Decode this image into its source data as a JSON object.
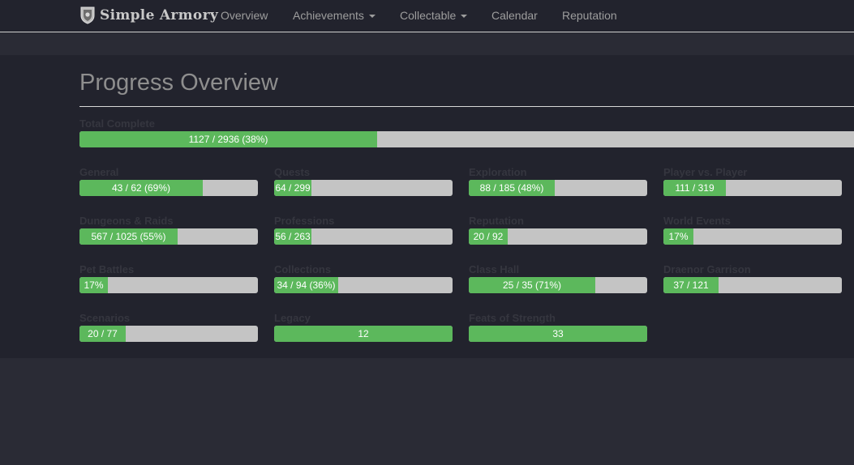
{
  "nav": {
    "brand": "Simple Armory",
    "items": [
      {
        "label": "Overview",
        "dropdown": false
      },
      {
        "label": "Achievements",
        "dropdown": true
      },
      {
        "label": "Collectable",
        "dropdown": true
      },
      {
        "label": "Calendar",
        "dropdown": false
      },
      {
        "label": "Reputation",
        "dropdown": false
      }
    ]
  },
  "page": {
    "title": "Progress Overview"
  },
  "total": {
    "label": "Total Complete",
    "text": "1127 / 2936 (38%)",
    "fraction": 0.384
  },
  "categories": [
    {
      "label": "General",
      "text": "43 / 62 (69%)",
      "fraction": 0.69
    },
    {
      "label": "Quests",
      "text": "64 / 299",
      "fraction": 0.21
    },
    {
      "label": "Exploration",
      "text": "88 / 185 (48%)",
      "fraction": 0.48
    },
    {
      "label": "Player vs. Player",
      "text": "111 / 319",
      "fraction": 0.35
    },
    {
      "label": "Dungeons & Raids",
      "text": "567 / 1025 (55%)",
      "fraction": 0.55
    },
    {
      "label": "Professions",
      "text": "56 / 263",
      "fraction": 0.21
    },
    {
      "label": "Reputation",
      "text": "20 / 92",
      "fraction": 0.22
    },
    {
      "label": "World Events",
      "text": "17%",
      "fraction": 0.17
    },
    {
      "label": "Pet Battles",
      "text": "17%",
      "fraction": 0.16
    },
    {
      "label": "Collections",
      "text": "34 / 94 (36%)",
      "fraction": 0.36
    },
    {
      "label": "Class Hall",
      "text": "25 / 35 (71%)",
      "fraction": 0.71
    },
    {
      "label": "Draenor Garrison",
      "text": "37 / 121",
      "fraction": 0.31
    },
    {
      "label": "Scenarios",
      "text": "20 / 77",
      "fraction": 0.26
    },
    {
      "label": "Legacy",
      "text": "12",
      "fraction": 1.0
    },
    {
      "label": "Feats of Strength",
      "text": "33",
      "fraction": 1.0
    }
  ],
  "colors": {
    "fill": "#5cb85c",
    "track": "#c4c4c4",
    "navbar": "#22232d",
    "background": "#2a2b35"
  }
}
